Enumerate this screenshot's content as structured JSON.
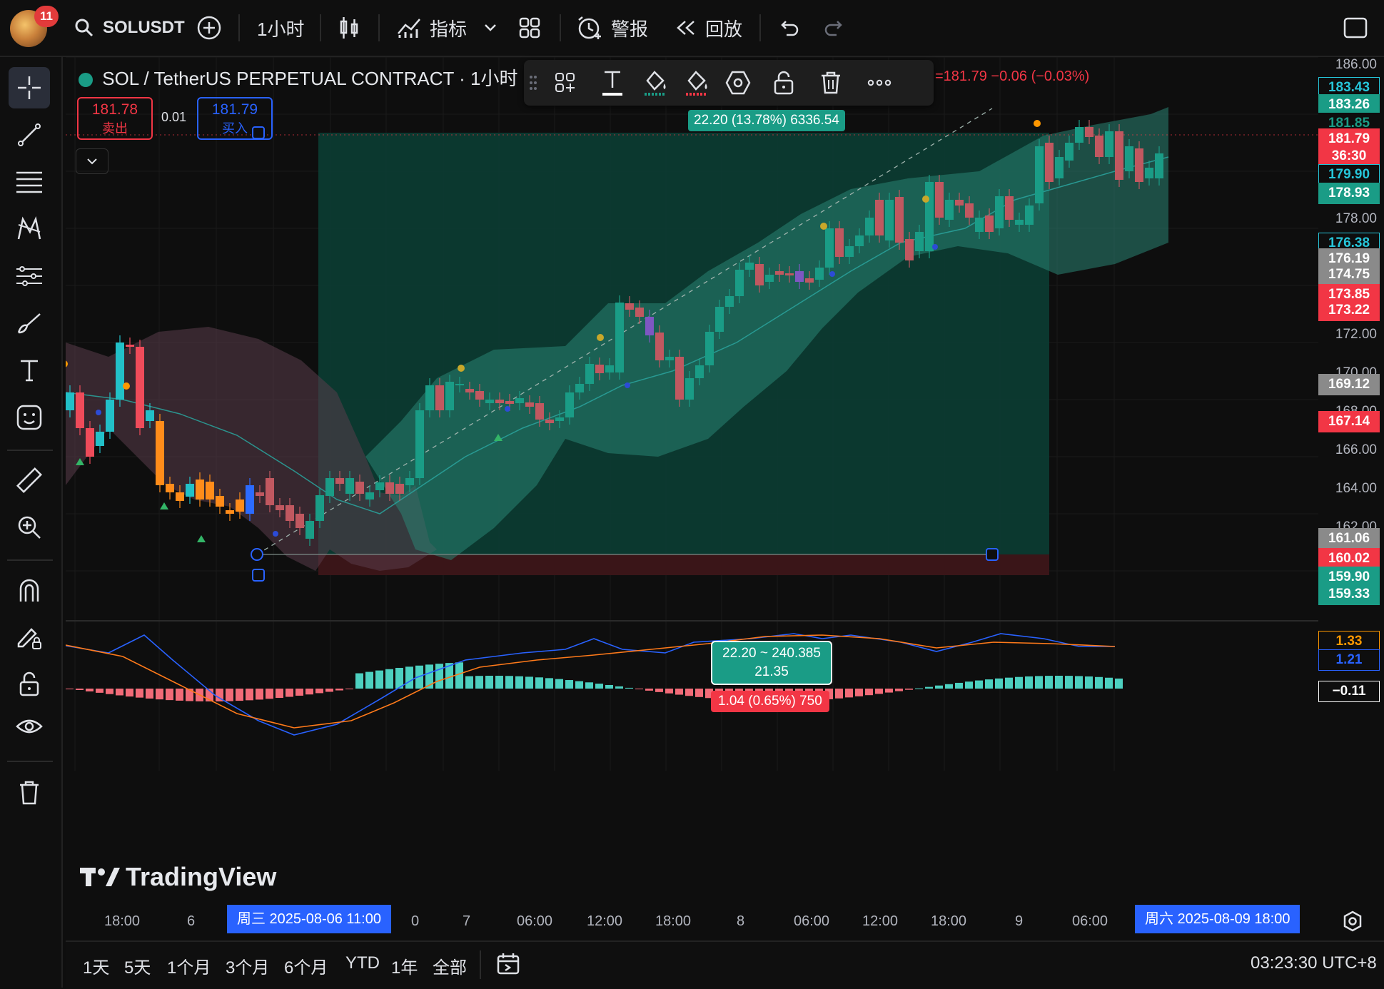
{
  "topbar": {
    "notifications": "11",
    "symbol": "SOLUSDT",
    "interval": "1小时",
    "indicators_label": "指标",
    "alerts_label": "警报",
    "replay_label": "回放"
  },
  "legend": {
    "title": "SOL / TetherUS PERPETUAL CONTRACT · 1小时 ·",
    "ohlc_tail": "=181.79  −0.06 (−0.03%)",
    "sell_price": "181.78",
    "sell_label": "卖出",
    "spread": "0.01",
    "buy_price": "181.79",
    "buy_label": "买入"
  },
  "position": {
    "profit_label": "22.20 (13.78%) 6336.54",
    "center_line1": "22.20 ~ 240.385",
    "center_line2": "21.35",
    "stop_label": "1.04 (0.65%) 750"
  },
  "price_axis": {
    "ticks": [
      "186.00",
      "178.00",
      "172.00",
      "170.00",
      "168.00",
      "166.00",
      "164.00",
      "162.00"
    ],
    "labels": [
      {
        "text": "183.43",
        "fg": "#26c6da",
        "bg": "#0e0e0e",
        "border": "#26c6da"
      },
      {
        "text": "183.26",
        "fg": "#ffffff",
        "bg": "#1a9c86",
        "border": "#1a9c86"
      },
      {
        "text": "181.85",
        "fg": "#1a9c86",
        "bg": "#0e0e0e",
        "border": "#0e0e0e"
      },
      {
        "text": "181.79",
        "fg": "#ffffff",
        "bg": "#f23645",
        "border": "#f23645"
      },
      {
        "text": "36:30",
        "fg": "#ffffff",
        "bg": "#f23645",
        "border": "#f23645"
      },
      {
        "text": "179.90",
        "fg": "#26c6da",
        "bg": "#0e0e0e",
        "border": "#26c6da"
      },
      {
        "text": "178.93",
        "fg": "#ffffff",
        "bg": "#1a9c86",
        "border": "#1a9c86"
      },
      {
        "text": "176.38",
        "fg": "#26c6da",
        "bg": "#0e0e0e",
        "border": "#26c6da"
      },
      {
        "text": "176.19",
        "fg": "#ffffff",
        "bg": "#8a8a8a",
        "border": "#8a8a8a"
      },
      {
        "text": "174.75",
        "fg": "#ffffff",
        "bg": "#8a8a8a",
        "border": "#8a8a8a"
      },
      {
        "text": "173.85",
        "fg": "#ffffff",
        "bg": "#f23645",
        "border": "#f23645"
      },
      {
        "text": "173.22",
        "fg": "#ffffff",
        "bg": "#f23645",
        "border": "#f23645"
      },
      {
        "text": "169.12",
        "fg": "#ffffff",
        "bg": "#8a8a8a",
        "border": "#8a8a8a"
      },
      {
        "text": "167.14",
        "fg": "#ffffff",
        "bg": "#f23645",
        "border": "#f23645"
      },
      {
        "text": "161.06",
        "fg": "#ffffff",
        "bg": "#8a8a8a",
        "border": "#8a8a8a"
      },
      {
        "text": "160.02",
        "fg": "#ffffff",
        "bg": "#f23645",
        "border": "#f23645"
      },
      {
        "text": "159.90",
        "fg": "#ffffff",
        "bg": "#1a9c86",
        "border": "#1a9c86"
      },
      {
        "text": "159.33",
        "fg": "#ffffff",
        "bg": "#1a9c86",
        "border": "#1a9c86"
      }
    ],
    "macd_labels": [
      {
        "text": "1.33",
        "fg": "#ff9800",
        "border": "#ff9800"
      },
      {
        "text": "1.21",
        "fg": "#2962ff",
        "border": "#2962ff"
      },
      {
        "text": "−0.11",
        "fg": "#ffffff",
        "border": "#ffffff"
      }
    ]
  },
  "time_axis": {
    "ticks": [
      "18:00",
      "6",
      "0",
      "7",
      "06:00",
      "12:00",
      "18:00",
      "8",
      "06:00",
      "12:00",
      "18:00",
      "9",
      "06:00"
    ],
    "cursor_left": "周三 2025-08-06   11:00",
    "cursor_right": "周六 2025-08-09   18:00"
  },
  "watermark": "TradingView",
  "bottombar": {
    "ranges": [
      "1天",
      "5天",
      "1个月",
      "3个月",
      "6个月",
      "YTD",
      "1年",
      "全部"
    ],
    "clock": "03:23:30 UTC+8"
  }
}
